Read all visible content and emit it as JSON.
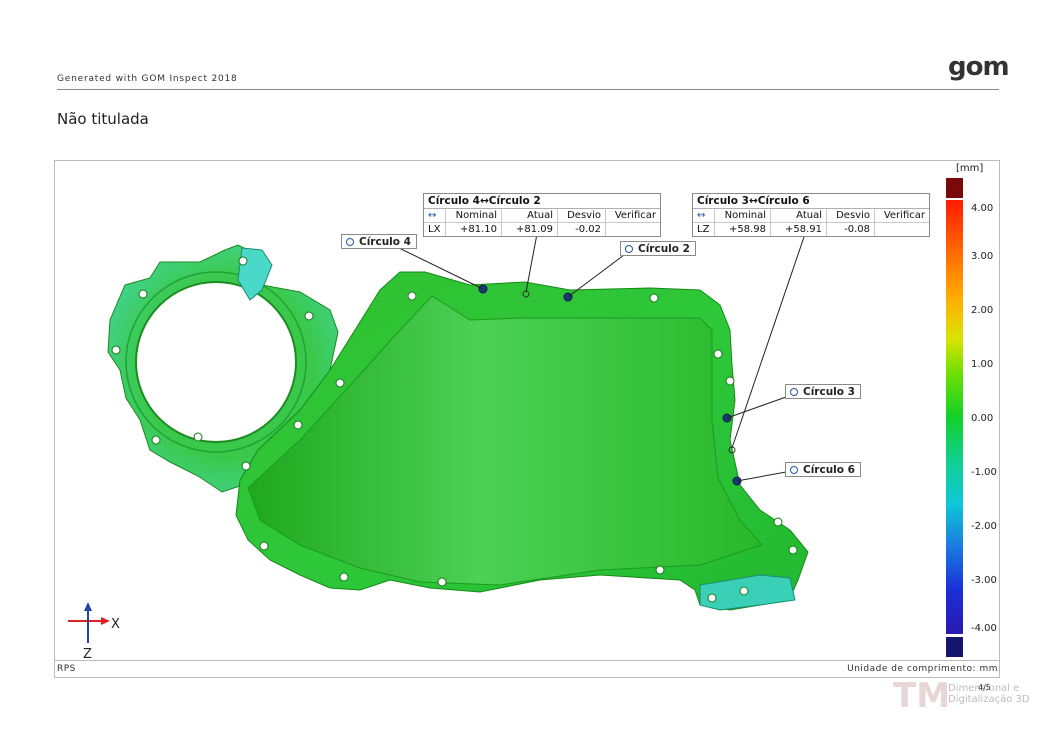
{
  "header": {
    "generated_text": "Generated with GOM Inspect 2018",
    "logo_text": "gom",
    "page_title": "Não titulada"
  },
  "footer": {
    "left_label": "RPS",
    "right_label": "Unidade de comprimento: mm",
    "page_number": "4/5"
  },
  "table_c4_c2": {
    "title": "Círculo 4↔Círculo 2",
    "headers": [
      "↔",
      "Nominal",
      "Atual",
      "Desvio",
      "Verificar"
    ],
    "row": [
      "LX",
      "+81.10",
      "+81.09",
      "-0.02",
      ""
    ]
  },
  "table_c3_c6": {
    "title": "Círculo 3↔Círculo 6",
    "headers": [
      "↔",
      "Nominal",
      "Atual",
      "Desvio",
      "Verificar"
    ],
    "row": [
      "LZ",
      "+58.98",
      "+58.91",
      "-0.08",
      ""
    ]
  },
  "labels": {
    "c4": "Círculo 4",
    "c2": "Círculo 2",
    "c3": "Círculo 3",
    "c6": "Círculo 6"
  },
  "scale": {
    "unit": "[mm]",
    "ticks": [
      "4.00",
      "3.00",
      "2.00",
      "1.00",
      "0.00",
      "-1.00",
      "-2.00",
      "-3.00",
      "-4.00"
    ],
    "colors": {
      "max": "#7a0a0a",
      "min": "#14166e",
      "nominal": "#12d02a"
    }
  },
  "axes": {
    "x": "X",
    "z": "Z"
  },
  "watermark": {
    "line1": "Dimensional e",
    "line2": "Digitalização 3D"
  }
}
